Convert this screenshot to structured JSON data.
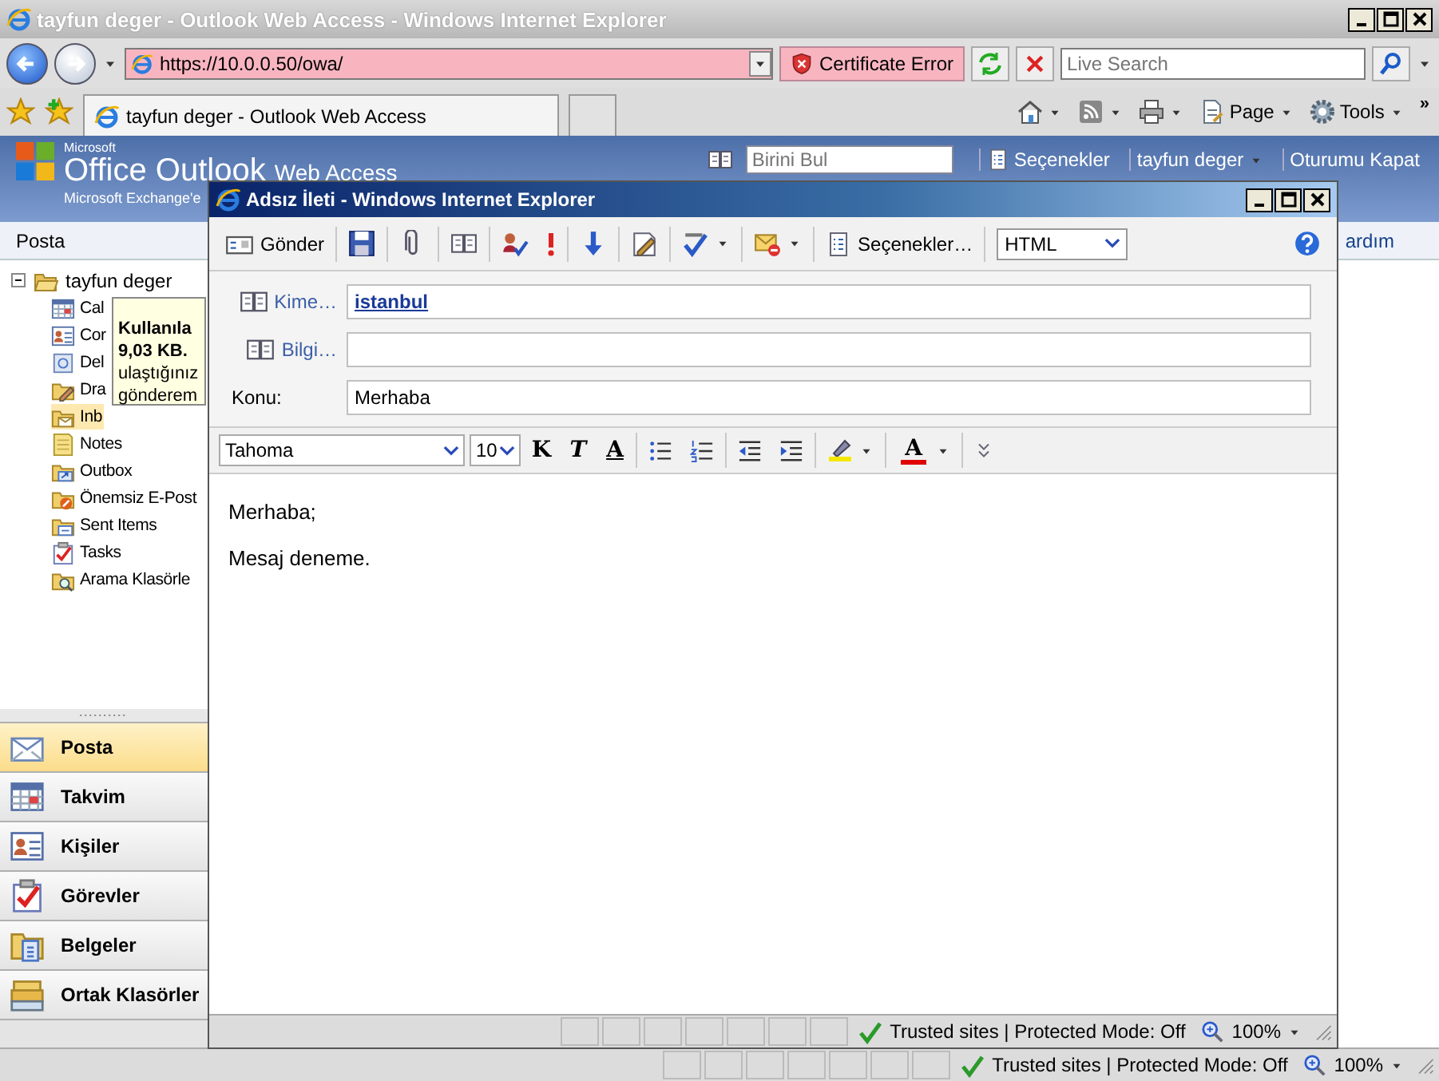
{
  "browser": {
    "title": "tayfun deger - Outlook Web Access - Windows Internet Explorer",
    "address": "https://10.0.0.50/owa/",
    "certificate": "Certificate Error",
    "search": {
      "placeholder": "Live Search"
    },
    "tab": "tayfun deger - Outlook Web Access",
    "commands": [
      "Page",
      "Tools"
    ],
    "chevron": "»"
  },
  "owa": {
    "brand": {
      "small": "Microsoft",
      "name": "Office Outlook",
      "suffix": "Web Access",
      "tagline": "Microsoft Exchange'e"
    },
    "find": {
      "placeholder": "Birini Bul"
    },
    "options": "Seçenekler",
    "user": "tayfun deger",
    "logout": "Oturumu Kapat",
    "help": "ardım",
    "pane_title": "Posta",
    "tree": {
      "label": "tayfun deger",
      "expanded": true,
      "children": [
        {
          "label": "Cal",
          "kind": "calendar",
          "selected": false
        },
        {
          "label": "Cor",
          "kind": "contacts",
          "selected": false
        },
        {
          "label": "Del",
          "kind": "trash",
          "selected": false
        },
        {
          "label": "Dra",
          "kind": "drafts",
          "selected": false
        },
        {
          "label": "Inb",
          "kind": "inbox",
          "selected": true
        },
        {
          "label": "Notes",
          "kind": "notes",
          "selected": false
        },
        {
          "label": "Outbox",
          "kind": "outbox",
          "selected": false
        },
        {
          "label": "Önemsiz E-Post",
          "kind": "junk",
          "selected": false
        },
        {
          "label": "Sent Items",
          "kind": "sent",
          "selected": false
        },
        {
          "label": "Tasks",
          "kind": "tasks",
          "selected": false
        },
        {
          "label": "Arama Klasörle",
          "kind": "search",
          "selected": false
        }
      ]
    },
    "tooltip": [
      {
        "text": "Kullanıla",
        "bold": true
      },
      {
        "text": "9,03 KB.",
        "bold": true
      },
      {
        "text": "ulaştığınız",
        "bold": false
      },
      {
        "text": "gönderem",
        "bold": false
      }
    ],
    "nav": [
      {
        "label": "Posta",
        "kind": "mail",
        "selected": true
      },
      {
        "label": "Takvim",
        "kind": "calendar",
        "selected": false
      },
      {
        "label": "Kişiler",
        "kind": "contacts",
        "selected": false
      },
      {
        "label": "Görevler",
        "kind": "tasks",
        "selected": false
      },
      {
        "label": "Belgeler",
        "kind": "documents",
        "selected": false
      },
      {
        "label": "Ortak Klasörler",
        "kind": "public",
        "selected": false
      }
    ]
  },
  "status": {
    "zone": "Trusted sites | Protected Mode: Off",
    "zoom": "100%"
  },
  "popup": {
    "title": "Adsız İleti - Windows Internet Explorer",
    "send": "Gönder",
    "options": "Seçenekler…",
    "format": "HTML",
    "to": {
      "label": "Kime…",
      "value": "istanbul"
    },
    "cc": {
      "label": "Bilgi…"
    },
    "subject": {
      "label": "Konu:",
      "value": "Merhaba"
    },
    "font": "Tahoma",
    "size": "10",
    "styles": [
      {
        "label": "K",
        "kind": "bold"
      },
      {
        "label": "T",
        "kind": "italic"
      },
      {
        "label": "A",
        "kind": "underline"
      }
    ],
    "font_color": "A",
    "body": [
      "Merhaba;",
      "Mesaj deneme."
    ],
    "status": {
      "zone": "Trusted sites | Protected Mode: Off",
      "zoom": "100%"
    }
  }
}
